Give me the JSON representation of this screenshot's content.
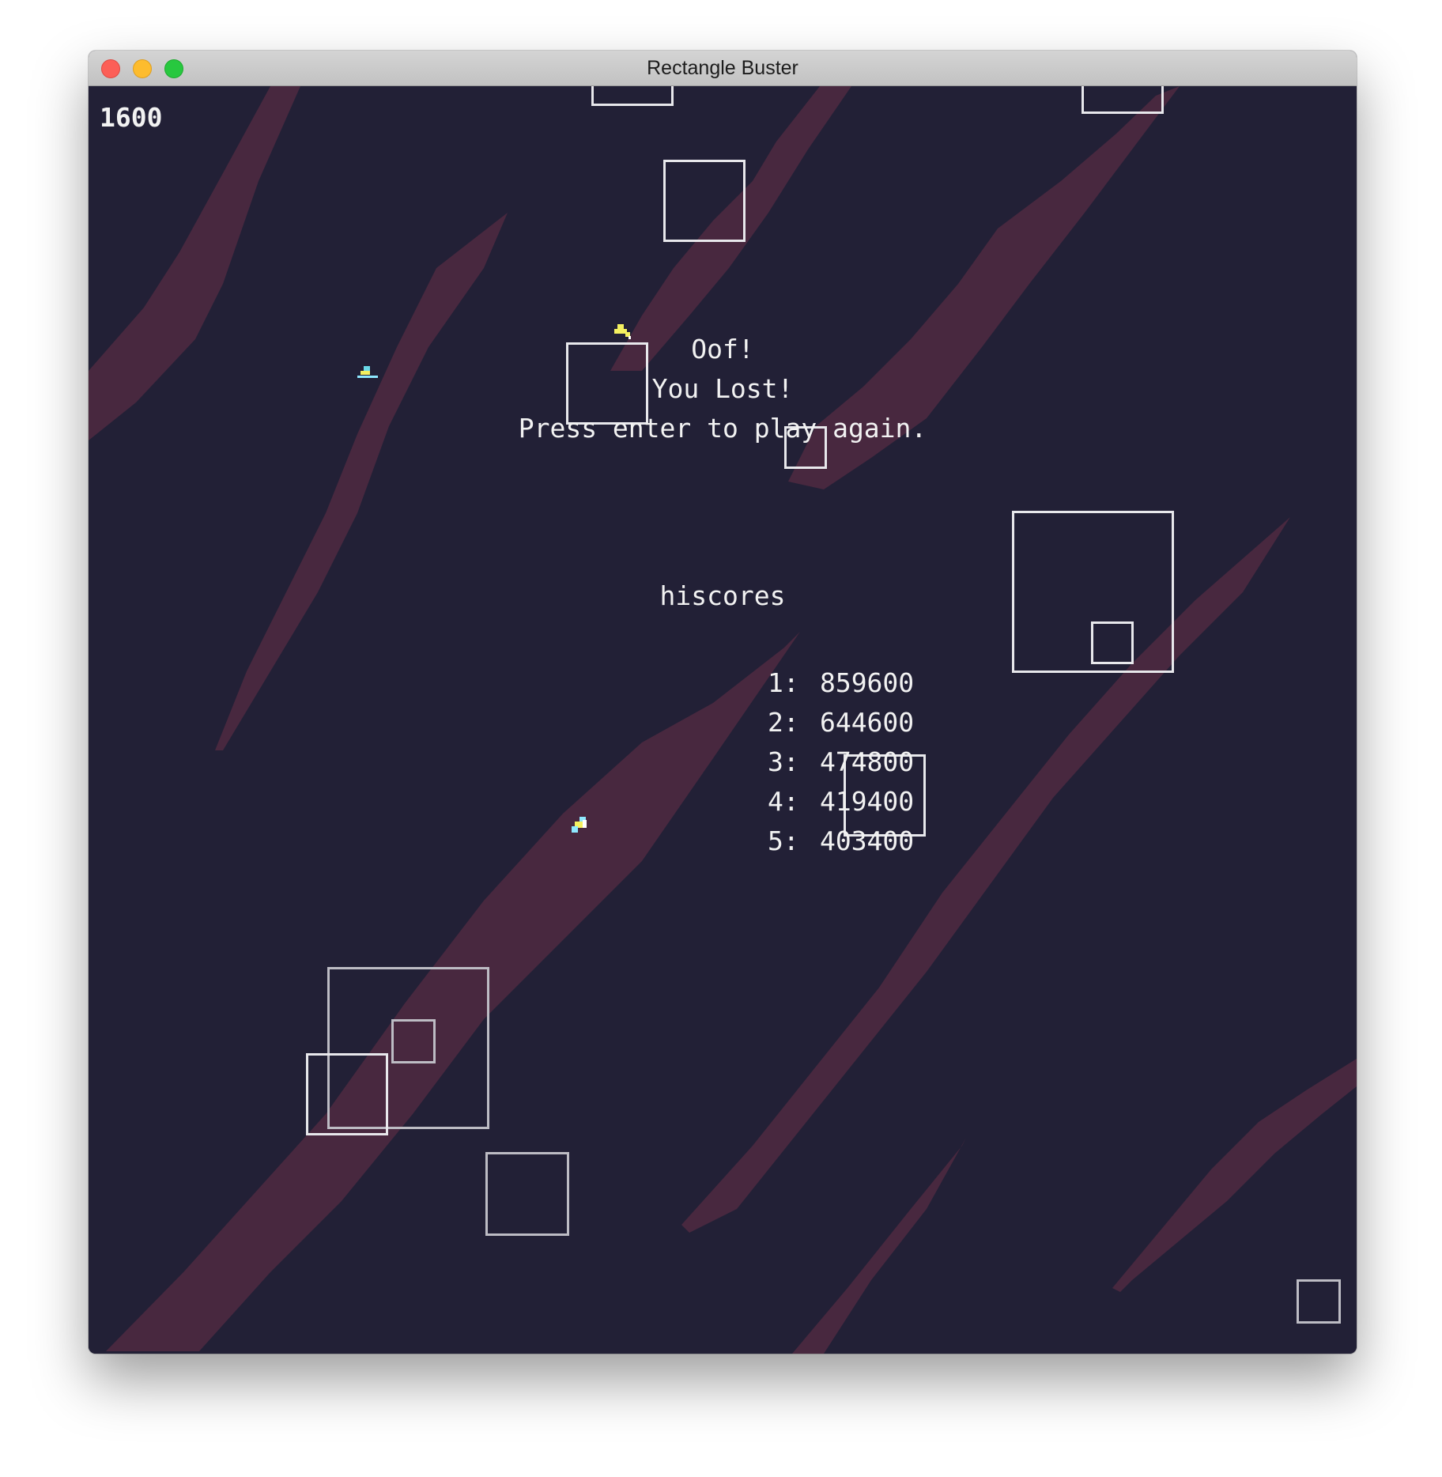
{
  "window": {
    "title": "Rectangle Buster",
    "buttons": [
      "close-button",
      "minimize-button",
      "zoom-button"
    ]
  },
  "game": {
    "score": "1600",
    "messages": {
      "line1": "Oof!",
      "line2": "You Lost!",
      "line3": "Press enter to play again."
    },
    "hiscores": {
      "title": "hiscores",
      "entries": [
        {
          "rank": "1:",
          "score": "859600"
        },
        {
          "rank": "2:",
          "score": "644600"
        },
        {
          "rank": "3:",
          "score": "474800"
        },
        {
          "rank": "4:",
          "score": "419400"
        },
        {
          "rank": "5:",
          "score": "403400"
        }
      ]
    },
    "colors": {
      "background": "#222036",
      "streak": "#48283f",
      "rectangle_outline": "#e8e8ec",
      "text": "#f2f2f2",
      "particle_yellow": "#f4f060",
      "particle_cyan": "#8ee8ff"
    }
  }
}
